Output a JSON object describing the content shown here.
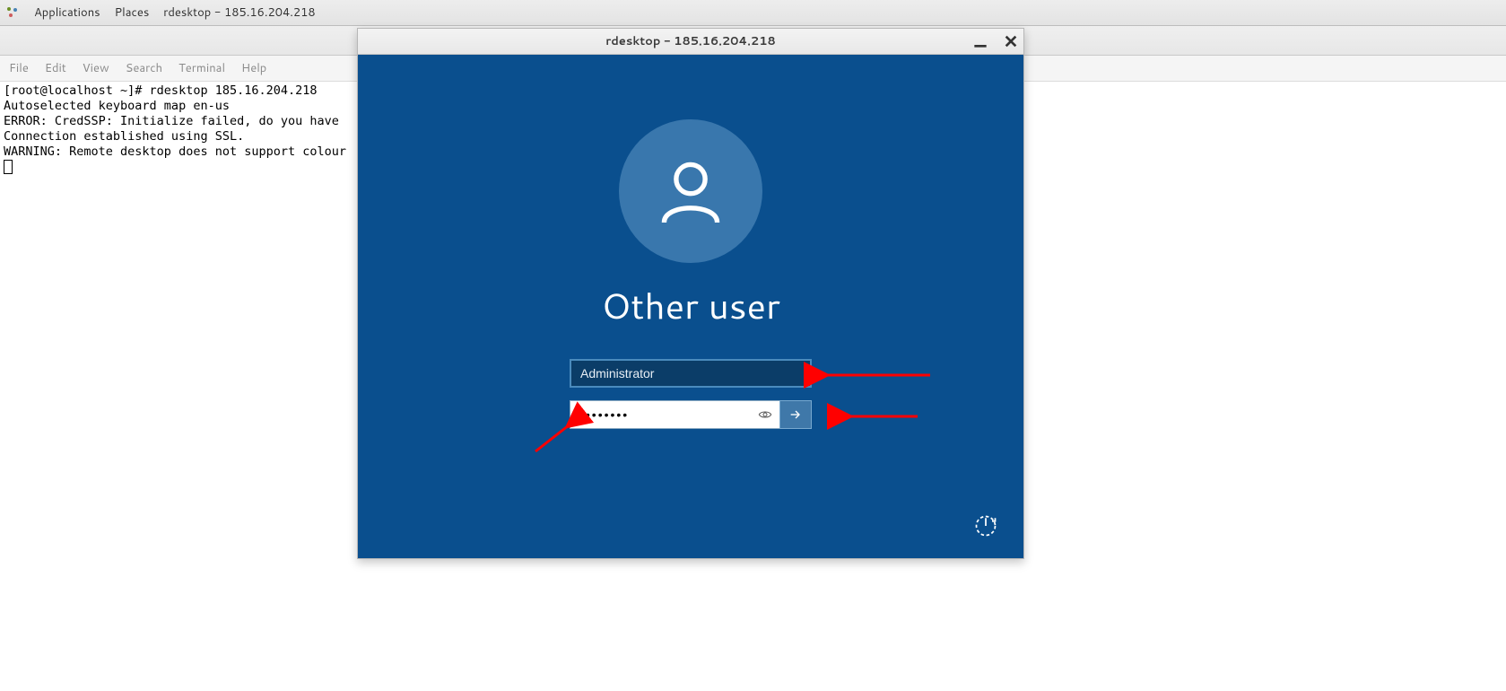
{
  "gnome": {
    "applications": "Applications",
    "places": "Places",
    "taskbar_app": "rdesktop - 185.16.204.218"
  },
  "terminal_menu": {
    "file": "File",
    "edit": "Edit",
    "view": "View",
    "search": "Search",
    "terminal": "Terminal",
    "help": "Help"
  },
  "terminal_output": {
    "line1": "[root@localhost ~]# rdesktop 185.16.204.218",
    "line2": "Autoselected keyboard map en-us",
    "line3": "ERROR: CredSSP: Initialize failed, do you have",
    "line4": "Connection established using SSL.",
    "line5": "WARNING: Remote desktop does not support colour"
  },
  "rdp": {
    "title": "rdesktop - 185.16.204.218",
    "heading": "Other user",
    "username": "Administrator",
    "password_masked": "••••••••"
  }
}
